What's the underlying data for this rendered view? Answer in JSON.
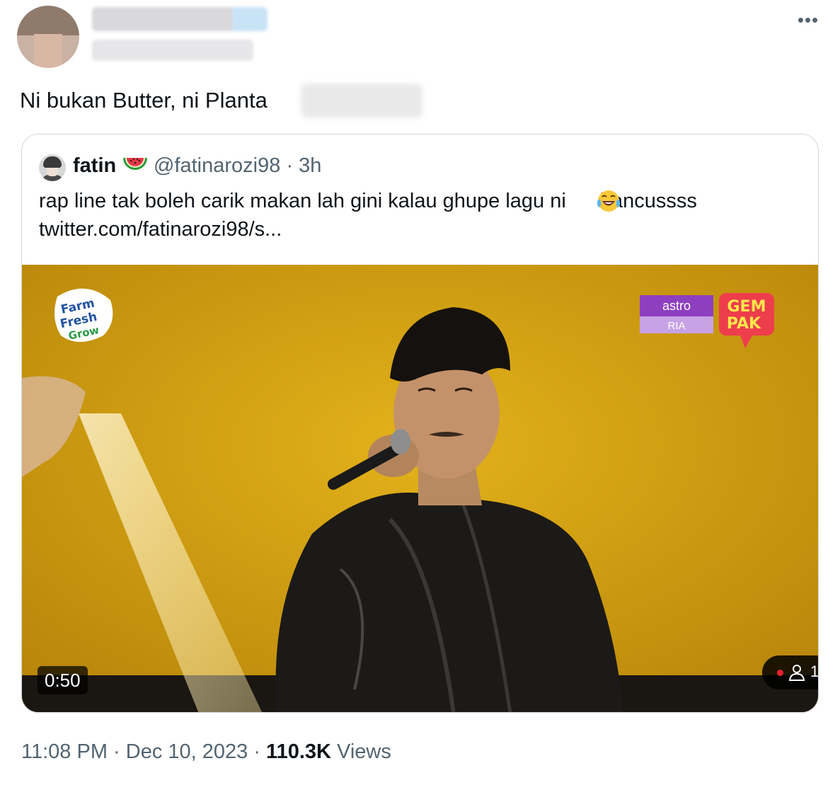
{
  "tweet": {
    "text": "Ni bukan Butter, ni Planta",
    "timestamp": "11:08 PM · Dec 10, 2023",
    "views_count": "110.3K",
    "views_label": "Views"
  },
  "quoted": {
    "name": "fatin",
    "handle": "@fatinarozi98",
    "time": "3h",
    "text_before": "rap line tak boleh carik makan lah gini kalau ghupe lagu ni",
    "text_after": " hancussss",
    "link": "twitter.com/fatinarozi98/s...",
    "name_emoji": "watermelon-icon",
    "inline_emoji": "face-with-tears-of-joy-icon"
  },
  "video": {
    "duration": "0:50",
    "logo_farm": [
      "Farm",
      "Fresh",
      "Grow"
    ],
    "logo_astro": "astro",
    "logo_ria": "RIA",
    "logo_gempak": [
      "GEM",
      "PAK"
    ],
    "viewer_count": "1"
  },
  "colors": {
    "accent_text": "#0f1419",
    "muted_text": "#536471",
    "border": "#cfd9de",
    "video_bg": "#d4a20c"
  }
}
